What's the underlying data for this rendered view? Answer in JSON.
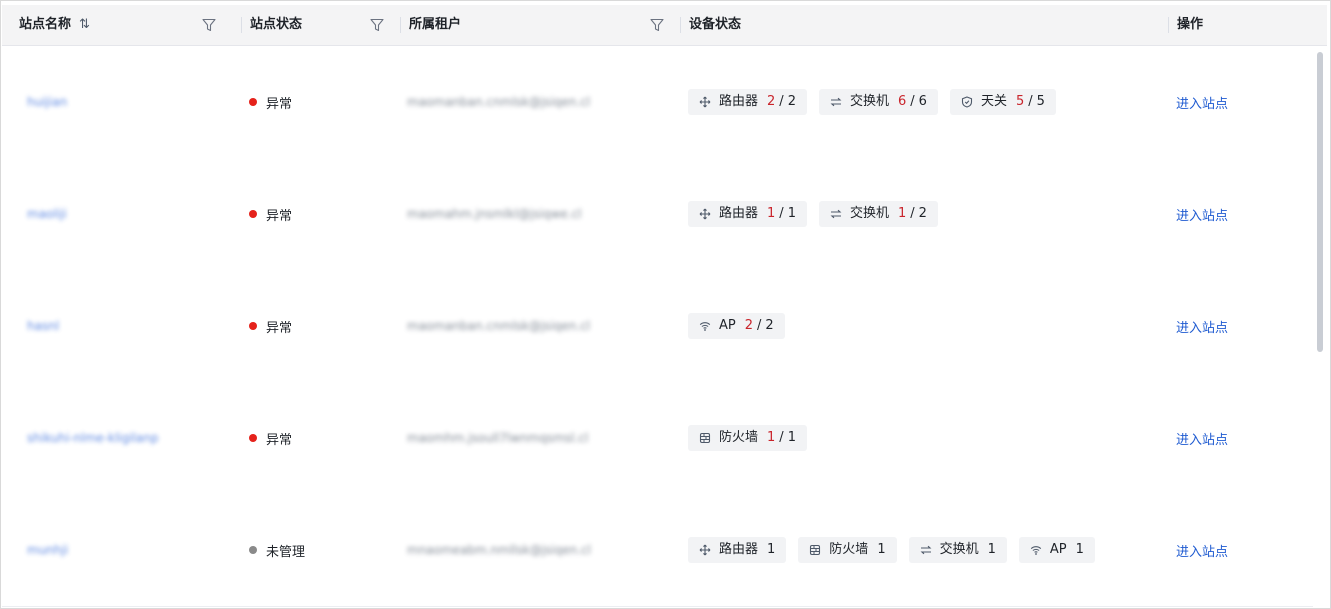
{
  "table": {
    "columns": {
      "site_name": "站点名称",
      "site_status": "站点状态",
      "tenant": "所属租户",
      "device_status": "设备状态",
      "action": "操作"
    },
    "sort_icon": "sort-arrows-icon",
    "filter_icon": "filter-funnel-icon",
    "status_colors": {
      "abnormal": "#e5221b",
      "unmanaged": "#8a8a8a"
    },
    "rows": [
      {
        "site_name": "huijian",
        "status": "异常",
        "status_color": "#e5221b",
        "tenant": "maomanban.cnmlsk@jsiqen.cl",
        "devices": [
          {
            "icon": "router-icon",
            "label": "路由器",
            "abnormal": "2",
            "total": "2"
          },
          {
            "icon": "switch-icon",
            "label": "交换机",
            "abnormal": "6",
            "total": "6"
          },
          {
            "icon": "gateway-icon",
            "label": "天关",
            "abnormal": "5",
            "total": "5"
          }
        ],
        "action": "进入站点"
      },
      {
        "site_name": "maoliji",
        "status": "异常",
        "status_color": "#e5221b",
        "tenant": "maomahm.jnsmlkl@jsiqwe.cl",
        "devices": [
          {
            "icon": "router-icon",
            "label": "路由器",
            "abnormal": "1",
            "total": "1"
          },
          {
            "icon": "switch-icon",
            "label": "交换机",
            "abnormal": "1",
            "total": "2"
          }
        ],
        "action": "进入站点"
      },
      {
        "site_name": "hasnl",
        "status": "异常",
        "status_color": "#e5221b",
        "tenant": "maomanban.cnmlsk@jsiqen.cl",
        "devices": [
          {
            "icon": "wifi-icon",
            "label": "AP",
            "abnormal": "2",
            "total": "2"
          }
        ],
        "action": "进入站点"
      },
      {
        "site_name": "shikuhi-nlme-kligilanp",
        "status": "异常",
        "status_color": "#e5221b",
        "tenant": "maomhm.jsoull7lwnmqsmsl.cl",
        "devices": [
          {
            "icon": "firewall-icon",
            "label": "防火墙",
            "abnormal": "1",
            "total": "1"
          }
        ],
        "action": "进入站点"
      },
      {
        "site_name": "munhji",
        "status": "未管理",
        "status_color": "#8a8a8a",
        "tenant": "mnaomeabm.nmllsk@jsiqen.cl",
        "devices": [
          {
            "icon": "router-icon",
            "label": "路由器",
            "count": "1"
          },
          {
            "icon": "firewall-icon",
            "label": "防火墙",
            "count": "1"
          },
          {
            "icon": "switch-icon",
            "label": "交换机",
            "count": "1"
          },
          {
            "icon": "wifi-icon",
            "label": "AP",
            "count": "1"
          }
        ],
        "action": "进入站点"
      }
    ]
  }
}
